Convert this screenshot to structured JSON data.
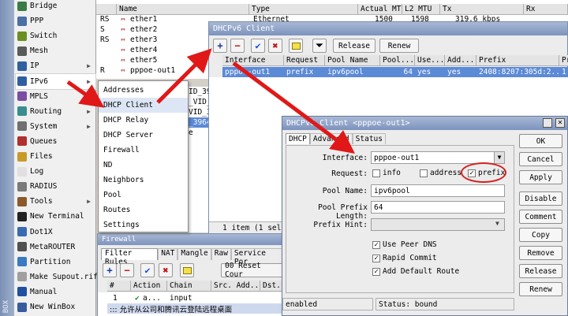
{
  "sidebar": {
    "vertical_label": "BOX",
    "items": [
      {
        "label": "Bridge",
        "color": "#3a7d44"
      },
      {
        "label": "PPP",
        "color": "#4a6fa5"
      },
      {
        "label": "Switch",
        "color": "#6b8e23"
      },
      {
        "label": "Mesh",
        "color": "#5a5a5a"
      },
      {
        "label": "IP",
        "color": "#2f5fa0",
        "arrow": "▶"
      },
      {
        "label": "IPv6",
        "color": "#2f5fa0",
        "arrow": "▶"
      },
      {
        "label": "MPLS",
        "color": "#7a4ea0",
        "arrow": "▶"
      },
      {
        "label": "Routing",
        "color": "#3a8d8d",
        "arrow": "▶"
      },
      {
        "label": "System",
        "color": "#707070",
        "arrow": "▶"
      },
      {
        "label": "Queues",
        "color": "#b03030"
      },
      {
        "label": "Files",
        "color": "#c89a2a"
      },
      {
        "label": "Log",
        "color": "#e0e0e0"
      },
      {
        "label": "RADIUS",
        "color": "#7a7a7a"
      },
      {
        "label": "Tools",
        "color": "#8a5a2a",
        "arrow": "▶"
      },
      {
        "label": "New Terminal",
        "color": "#222222"
      },
      {
        "label": "Dot1X",
        "color": "#3a6ab0"
      },
      {
        "label": "MetaROUTER",
        "color": "#505050"
      },
      {
        "label": "Partition",
        "color": "#3a7ac0"
      },
      {
        "label": "Make Supout.rif",
        "color": "#a0a0a0"
      },
      {
        "label": "Manual",
        "color": "#2050a0"
      },
      {
        "label": "New WinBox",
        "color": "#3a5aa0"
      }
    ]
  },
  "submenu": {
    "items": [
      "Addresses",
      "DHCP Client",
      "DHCP Relay",
      "DHCP Server",
      "Firewall",
      "ND",
      "Neighbors",
      "Pool",
      "Routes",
      "Settings"
    ]
  },
  "interfaces": {
    "headers": [
      "Name",
      "Type",
      "Actual MTU",
      "L2 MTU",
      "Tx",
      "Rx"
    ],
    "rows": [
      {
        "flag": "RS",
        "name": "ether1",
        "type": "Ethernet",
        "mtu": "1500",
        "l2": "1598",
        "tx": "319.6 kbps"
      },
      {
        "flag": "S",
        "name": "ether2",
        "type": "",
        "mtu": "",
        "l2": "",
        "tx": ""
      },
      {
        "flag": "RS",
        "name": "ether3",
        "type": "",
        "mtu": "",
        "l2": "",
        "tx": ""
      },
      {
        "flag": "",
        "name": "ether4",
        "type": "",
        "mtu": "",
        "l2": "",
        "tx": ""
      },
      {
        "flag": "",
        "name": "ether5",
        "type": "",
        "mtu": "",
        "l2": "",
        "tx": ""
      },
      {
        "flag": "R",
        "name": "pppoe-out1",
        "type": "",
        "mtu": "",
        "l2": "",
        "tx": ""
      }
    ],
    "partial_names": [
      "ID_396",
      "_VID_",
      "VID_39",
      "_3964",
      "e"
    ]
  },
  "dhcp_client": {
    "title": "DHCPv6 Client",
    "release_label": "Release",
    "renew_label": "Renew",
    "headers": [
      "Interface",
      "Request",
      "Pool Name",
      "Pool...",
      "Use...",
      "Add...",
      "Prefix",
      "Pr"
    ],
    "row": {
      "interface": "pppoe-out1",
      "request": "prefix",
      "pool_name": "ipv6pool",
      "pool_len": "64",
      "use_peer_dns": "yes",
      "add_default": "yes",
      "prefix": "2408:8207:305d:2...",
      "pr": "1"
    },
    "status": "1 item (1 select"
  },
  "dialog": {
    "title": "DHCPv6 Client <pppoe-out1>",
    "tabs": [
      "DHCP",
      "Advanced",
      "Status"
    ],
    "interface_label": "Interface:",
    "interface_value": "pppoe-out1",
    "request_label": "Request:",
    "request_options": [
      "info",
      "address",
      "prefix"
    ],
    "pool_name_label": "Pool Name:",
    "pool_name_value": "ipv6pool",
    "pool_prefix_label": "Pool Prefix Length:",
    "pool_prefix_value": "64",
    "prefix_hint_label": "Prefix Hint:",
    "prefix_hint_value": "",
    "checks": [
      "Use Peer DNS",
      "Rapid Commit",
      "Add Default Route"
    ],
    "buttons": [
      "OK",
      "Cancel",
      "Apply",
      "Disable",
      "Comment",
      "Copy",
      "Remove",
      "Release",
      "Renew"
    ],
    "status_left": "enabled",
    "status_right": "Status: bound"
  },
  "firewall": {
    "title": "Firewall",
    "tabs": [
      "Filter Rules",
      "NAT",
      "Mangle",
      "Raw",
      "Service Por"
    ],
    "reset_label": "00 Reset Cour",
    "headers": [
      "#",
      "Action",
      "Chain",
      "Src. Add...",
      "Dst."
    ],
    "row": {
      "num": "1",
      "action": "a...",
      "chain": "input"
    },
    "comment": "::: 允许从公司和腾讯云登陆远程桌面"
  }
}
